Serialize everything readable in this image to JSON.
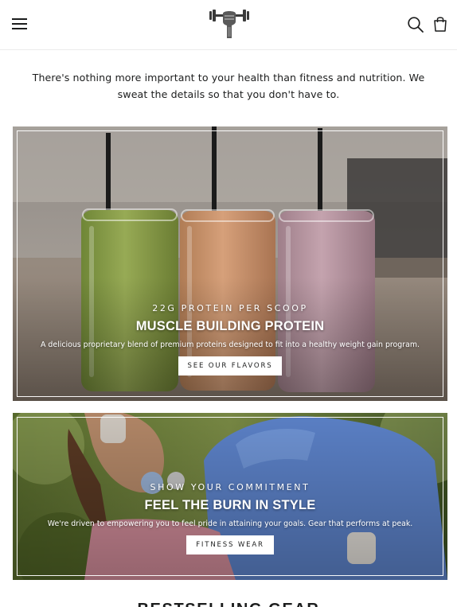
{
  "header": {
    "menu_icon": "hamburger-menu-icon",
    "logo_icon": "barbell-fist-logo-icon",
    "search_icon": "search-icon",
    "cart_icon": "shopping-bag-icon"
  },
  "intro": {
    "text": "There's nothing more important to your health than fitness and nutrition. We sweat the details so that you don't have to."
  },
  "promos": [
    {
      "eyebrow": "22G PROTEIN PER SCOOP",
      "headline": "MUSCLE BUILDING PROTEIN",
      "description": "A delicious proprietary blend of premium proteins designed to fit into a healthy weight gain program.",
      "cta": "SEE OUR FLAVORS",
      "image": "three-protein-shakes-green-peach-purple"
    },
    {
      "eyebrow": "SHOW YOUR COMMITMENT",
      "headline": "FEEL THE BURN IN STYLE",
      "description": "We're driven to empowering you to feel pride in attaining your goals. Gear that performs at peak.",
      "cta": "FITNESS WEAR",
      "image": "couple-in-fitness-apparel-outdoors"
    }
  ],
  "section": {
    "title": "BESTSELLING GEAR"
  },
  "colors": {
    "text": "#1c1d1d",
    "background": "#ffffff",
    "overlay_text": "#ffffff"
  }
}
